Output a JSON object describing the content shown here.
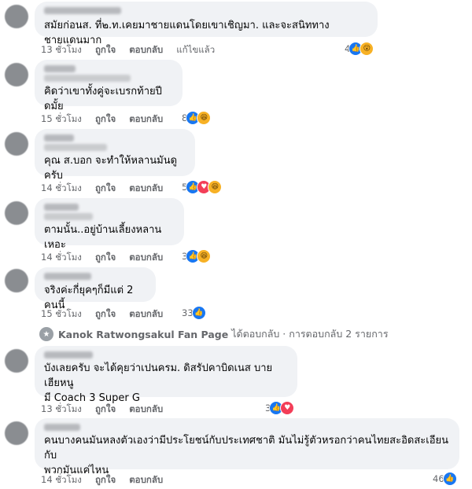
{
  "actions": {
    "like": "ถูกใจ",
    "reply": "ตอบกลับ",
    "edited": "แก้ไขแล้ว"
  },
  "comments": [
    {
      "text": "สมัยก่อนส. ที่๒.ท.เคยมาชายแดนโดยเขาเชิญมา. และจะสนิททางชายแดนมาก",
      "time": "13 ชั่วโมง",
      "reaction_count": "4",
      "reactions": [
        "like",
        "wow"
      ],
      "edited": true
    },
    {
      "text": "คิดว่าเขาทั้งคู่จะเบรกท้ายปีดมั้ย",
      "time": "15 ชั่วโมง",
      "reaction_count": "8",
      "reactions": [
        "like",
        "haha"
      ]
    },
    {
      "text": "คุณ ส.บอก จะทำให้หลานมันดูครับ",
      "time": "14 ชั่วโมง",
      "reaction_count": "5",
      "reactions": [
        "like",
        "love",
        "haha"
      ]
    },
    {
      "text": "ตามนั้น..อยู่บ้านเลี้ยงหลานเหอะ",
      "time": "14 ชั่วโมง",
      "reaction_count": "3",
      "reactions": [
        "like",
        "haha"
      ]
    },
    {
      "text": "จริงค่ะกี่ยุคๆก็มีแต่ 2 คนนี้",
      "time": "15 ชั่วโมง",
      "reaction_count": "33",
      "reactions": [
        "like"
      ]
    },
    {
      "text": "บังเลยครับ จะได้คุยว่าเปนครม. ดิสรัปคาบิดเนส บายเฮียหนู\nมี Coach 3 Super G",
      "time": "13 ชั่วโมง",
      "reaction_count": "3",
      "reactions": [
        "like",
        "love"
      ]
    },
    {
      "text": "คนบางคนมันหลงตัวเองว่ามีประโยชน์กับประเทศชาติ มันไม่รู้ตัวหรอกว่าคนไทยสะอิดสะเอียนกับ\nพวกมันแค่ไหน",
      "time": "14 ชั่วโมง",
      "reaction_count": "46",
      "reactions": [
        "like"
      ]
    }
  ],
  "reply_summary": {
    "name": "Kanok Ratwongsakul Fan Page",
    "text": "ได้ตอบกลับ · การตอบกลับ 2 รายการ"
  },
  "icons": {
    "like": "like-icon",
    "love": "love-icon",
    "haha": "haha-icon",
    "wow": "wow-icon"
  }
}
